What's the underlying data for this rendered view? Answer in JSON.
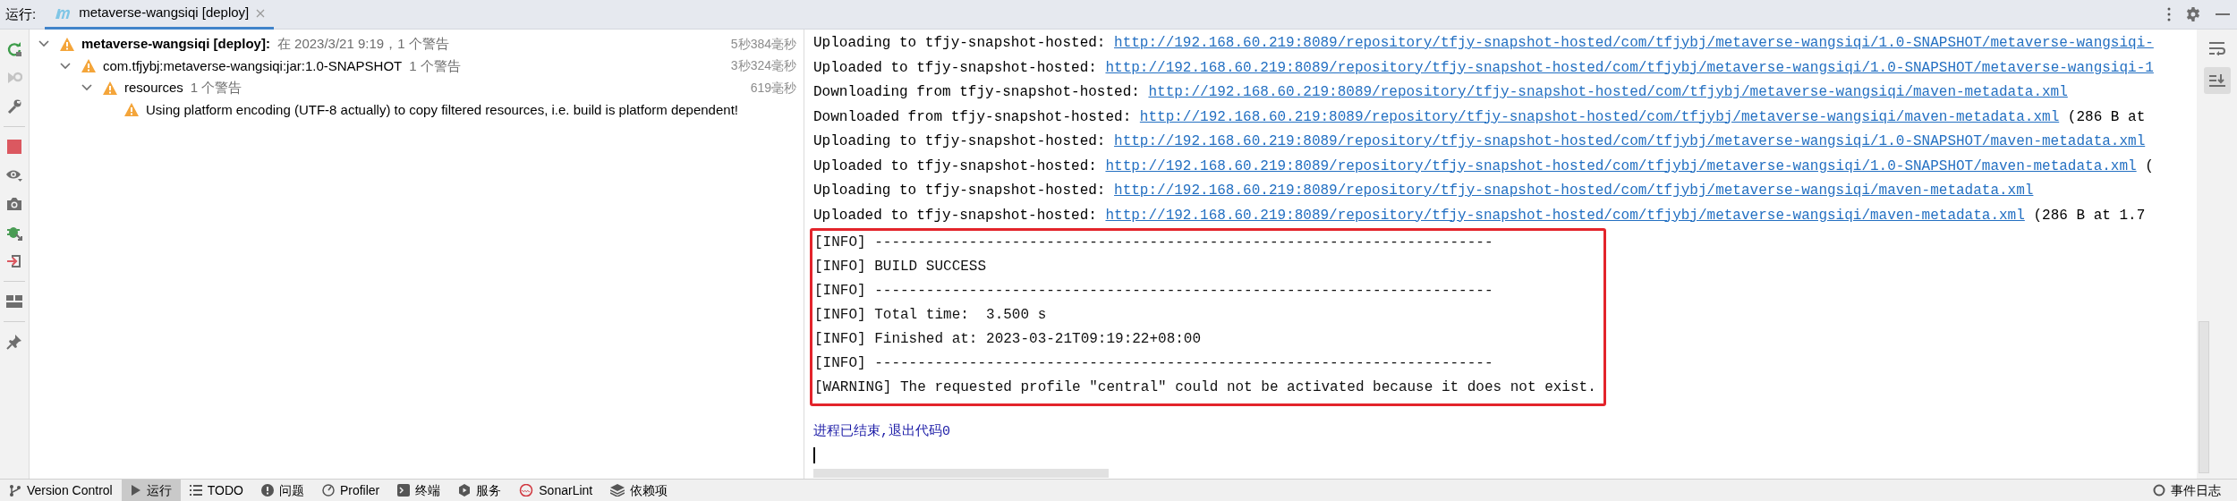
{
  "run_panel": {
    "label": "运行:",
    "tabs": [
      {
        "label": "metaverse-wangsiqi [deploy]",
        "selected": true
      }
    ]
  },
  "build_tree": [
    {
      "label": "metaverse-wangsiqi [deploy]:",
      "detail": "在 2023/3/21 9:19，1 个警告",
      "duration": "5秒384毫秒",
      "expanded": true,
      "children": [
        {
          "label": "com.tfjybj:metaverse-wangsiqi:jar:1.0-SNAPSHOT",
          "detail": "1 个警告",
          "duration": "3秒324毫秒",
          "expanded": true,
          "children": [
            {
              "label": "resources",
              "detail": "1 个警告",
              "duration": "619毫秒",
              "expanded": true,
              "children": [
                {
                  "label": "Using platform encoding (UTF-8 actually) to copy filtered resources, i.e. build is platform dependent!"
                }
              ]
            }
          ]
        }
      ]
    }
  ],
  "console": {
    "lines": [
      {
        "kind": "transfer",
        "text": "Uploading to tfjy-snapshot-hosted:",
        "link": "http://192.168.60.219:8089/repository/tfjy-snapshot-hosted/com/tfjybj/metaverse-wangsiqi/1.0-SNAPSHOT/metaverse-wangsiqi-"
      },
      {
        "kind": "transfer",
        "text": "Uploaded to tfjy-snapshot-hosted:",
        "link": "http://192.168.60.219:8089/repository/tfjy-snapshot-hosted/com/tfjybj/metaverse-wangsiqi/1.0-SNAPSHOT/metaverse-wangsiqi-1"
      },
      {
        "kind": "transfer",
        "text": "Downloading from tfjy-snapshot-hosted:",
        "link": "http://192.168.60.219:8089/repository/tfjy-snapshot-hosted/com/tfjybj/metaverse-wangsiqi/maven-metadata.xml"
      },
      {
        "kind": "transfer",
        "text": "Downloaded from tfjy-snapshot-hosted:",
        "link": "http://192.168.60.219:8089/repository/tfjy-snapshot-hosted/com/tfjybj/metaverse-wangsiqi/maven-metadata.xml",
        "suffix": "(286 B at"
      },
      {
        "kind": "transfer",
        "text": "Uploading to tfjy-snapshot-hosted:",
        "link": "http://192.168.60.219:8089/repository/tfjy-snapshot-hosted/com/tfjybj/metaverse-wangsiqi/1.0-SNAPSHOT/maven-metadata.xml"
      },
      {
        "kind": "transfer",
        "text": "Uploaded to tfjy-snapshot-hosted:",
        "link": "http://192.168.60.219:8089/repository/tfjy-snapshot-hosted/com/tfjybj/metaverse-wangsiqi/1.0-SNAPSHOT/maven-metadata.xml",
        "suffix": "("
      },
      {
        "kind": "transfer",
        "text": "Uploading to tfjy-snapshot-hosted:",
        "link": "http://192.168.60.219:8089/repository/tfjy-snapshot-hosted/com/tfjybj/metaverse-wangsiqi/maven-metadata.xml"
      },
      {
        "kind": "transfer",
        "text": "Uploaded to tfjy-snapshot-hosted:",
        "link": "http://192.168.60.219:8089/repository/tfjy-snapshot-hosted/com/tfjybj/metaverse-wangsiqi/maven-metadata.xml",
        "suffix": "(286 B at 1.7"
      }
    ],
    "highlighted_lines": [
      {
        "kind": "plain",
        "text": "[INFO] ------------------------------------------------------------------------"
      },
      {
        "kind": "plain",
        "text": "[INFO] BUILD SUCCESS"
      },
      {
        "kind": "plain",
        "text": "[INFO] ------------------------------------------------------------------------"
      },
      {
        "kind": "plain",
        "text": "[INFO] Total time:  3.500 s"
      },
      {
        "kind": "plain",
        "text": "[INFO] Finished at: 2023-03-21T09:19:22+08:00"
      },
      {
        "kind": "plain",
        "text": "[INFO] ------------------------------------------------------------------------"
      },
      {
        "kind": "plain",
        "text": "[WARNING] The requested profile \"central\" could not be activated because it does not exist."
      }
    ],
    "exit_message": "进程已结束,退出代码0"
  },
  "tool_windows": [
    {
      "label": "Version Control",
      "kind": "vcs",
      "selected": false
    },
    {
      "label": "运行",
      "kind": "run",
      "selected": true
    },
    {
      "label": "TODO",
      "kind": "todo",
      "selected": false
    },
    {
      "label": "问题",
      "kind": "problems",
      "selected": false
    },
    {
      "label": "Profiler",
      "kind": "profiler",
      "selected": false
    },
    {
      "label": "终端",
      "kind": "terminal",
      "selected": false
    },
    {
      "label": "服务",
      "kind": "services",
      "selected": false
    },
    {
      "label": "SonarLint",
      "kind": "sonar",
      "selected": false
    },
    {
      "label": "依赖项",
      "kind": "dependencies",
      "selected": false
    }
  ],
  "event_log": {
    "label": "事件日志"
  }
}
